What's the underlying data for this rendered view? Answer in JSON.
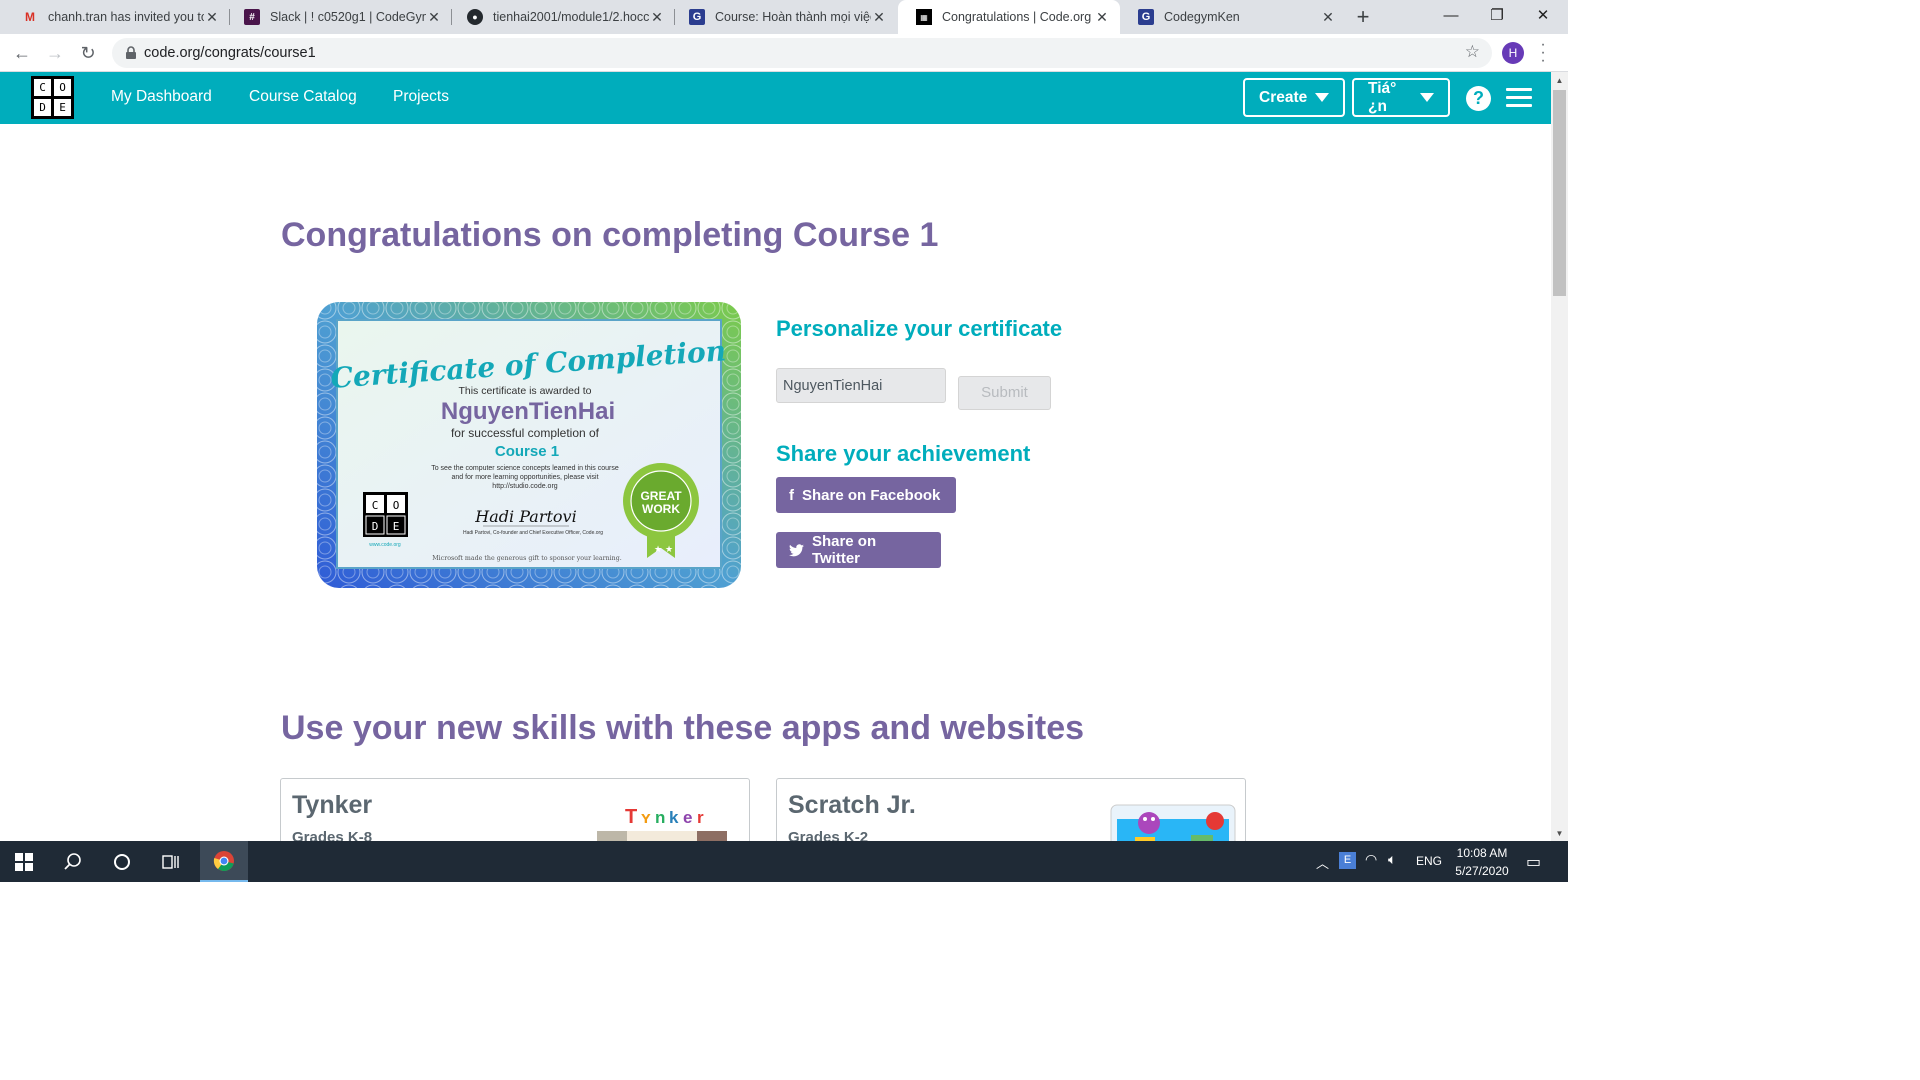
{
  "browser": {
    "tabs": [
      {
        "title": "chanh.tran has invited you to",
        "icon": "gmail-icon"
      },
      {
        "title": "Slack | ! c0520g1 | CodeGym",
        "icon": "slack-icon"
      },
      {
        "title": "tienhai2001/module1/2.hocc",
        "icon": "github-icon"
      },
      {
        "title": "Course: Hoàn thành mọi việc",
        "icon": "codegym-icon"
      },
      {
        "title": "Congratulations | Code.org",
        "icon": "codeorg-icon"
      },
      {
        "title": "CodegymKen",
        "icon": "codegym-icon"
      }
    ],
    "active_tab": 4,
    "url": "code.org/congrats/course1",
    "profile_initial": "H"
  },
  "header": {
    "logo_letters": [
      "C",
      "O",
      "D",
      "E"
    ],
    "nav": [
      "My Dashboard",
      "Course Catalog",
      "Projects"
    ],
    "create_label": "Create",
    "language_label": "Tiá°¿n",
    "help_label": "?"
  },
  "main": {
    "title": "Congratulations on completing Course 1",
    "certificate": {
      "heading": "Certificate of Completion",
      "awarded_line": "This certificate is awarded to",
      "name": "NguyenTienHai",
      "completion_line": "for successful completion of",
      "course": "Course 1",
      "visit_line_1": "To see the computer science concepts learned in this course",
      "visit_line_2": "and for more learning opportunities, please visit",
      "visit_url": "http://studio.code.org",
      "signature": "Hadi Partovi",
      "signer": "Hadi Partovi, Co-founder and Chief Executive Officer, Code.org",
      "site": "www.code.org",
      "badge_top": "GREAT",
      "badge_bottom": "WORK",
      "footer": "Microsoft made the generous gift to sponsor your learning."
    },
    "personalize_heading": "Personalize your certificate",
    "name_input_value": "NguyenTienHai",
    "submit_label": "Submit",
    "share_heading": "Share your achievement",
    "facebook_label": "Share on Facebook",
    "twitter_label": "Share on Twitter",
    "apps_heading": "Use your new skills with these apps and websites",
    "apps": [
      {
        "name": "Tynker",
        "grades": "Grades K-8"
      },
      {
        "name": "Scratch Jr.",
        "grades": "Grades K-2"
      }
    ]
  },
  "taskbar": {
    "language": "ENG",
    "time": "10:08 AM",
    "date": "5/27/2020"
  },
  "colors": {
    "brand_teal": "#00adbc",
    "brand_purple": "#7665a0",
    "taskbar": "#1f2a36"
  }
}
